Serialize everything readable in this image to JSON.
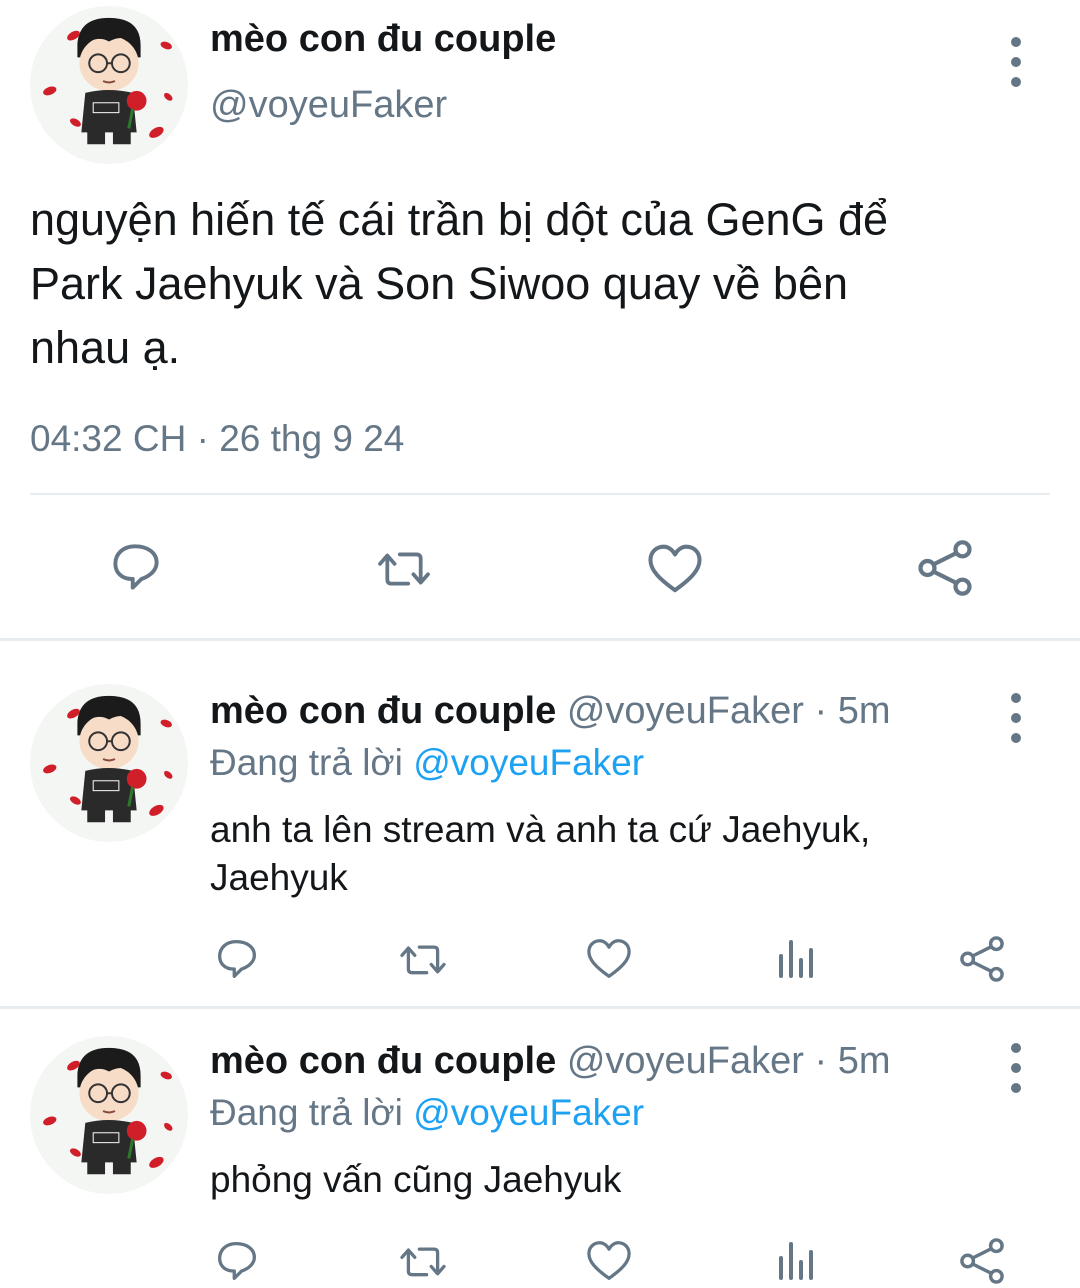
{
  "main_tweet": {
    "author_name": "mèo con đu couple",
    "handle": "@voyeuFaker",
    "text_lines": [
      "nguyện hiến tế cái trần bị dột của GenG để",
      "Park Jaehyuk và Son Siwoo quay về bên",
      "nhau ạ."
    ],
    "timestamp": "04:32 CH · 26 thg 9 24"
  },
  "replies": [
    {
      "author_name": "mèo con đu couple",
      "handle_time": "@voyeuFaker · 5m",
      "replying_prefix": "Đang trả lời",
      "replying_to": "@voyeuFaker",
      "text_lines": [
        "anh ta lên stream và anh ta cứ Jaehyuk,",
        "Jaehyuk"
      ]
    },
    {
      "author_name": "mèo con đu couple",
      "handle_time": "@voyeuFaker · 5m",
      "replying_prefix": "Đang trả lời",
      "replying_to": "@voyeuFaker",
      "text_lines": [
        "phỏng vấn cũng Jaehyuk"
      ]
    }
  ],
  "colors": {
    "text": "#14171a",
    "muted": "#657786",
    "link": "#1da1f2",
    "divider": "#e6ecf0"
  },
  "icons": [
    "more-vertical-icon",
    "reply-icon",
    "retweet-icon",
    "like-icon",
    "analytics-icon",
    "share-icon"
  ]
}
